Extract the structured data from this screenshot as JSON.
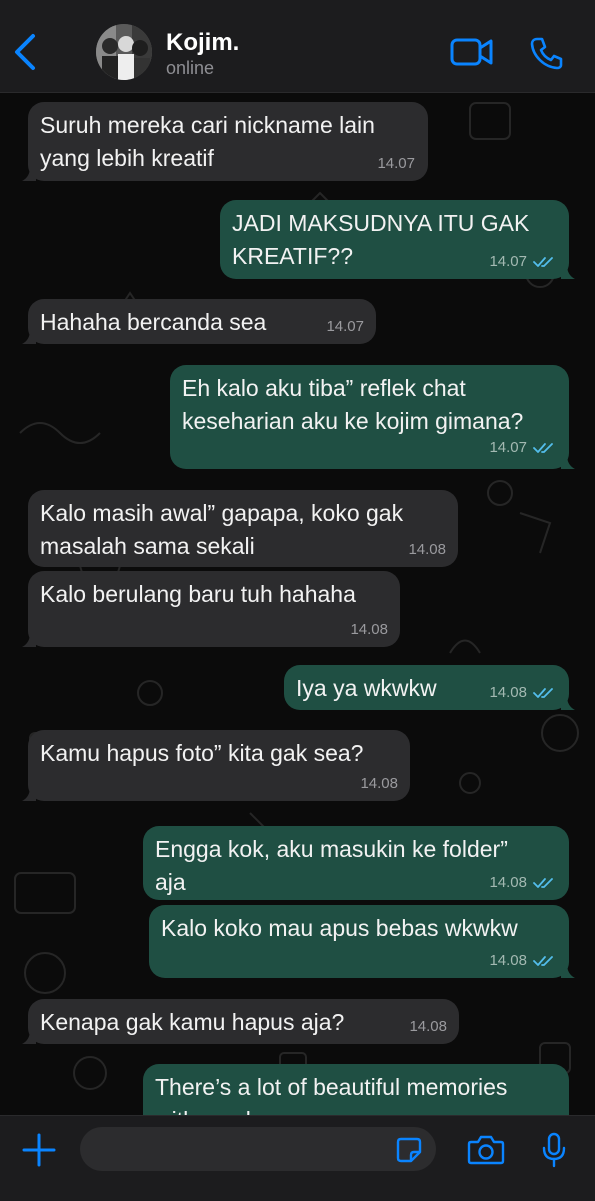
{
  "header": {
    "back_icon": "chevron-left-icon",
    "contact_name": "Kojim.",
    "status": "online",
    "video_icon": "video-camera-icon",
    "call_icon": "phone-icon"
  },
  "colors": {
    "accent": "#0a84ff",
    "incoming_bubble": "#2c2c2e",
    "outgoing_bubble": "#1f4f43",
    "read_ticks": "#53bdeb"
  },
  "messages": [
    {
      "direction": "incoming",
      "lines": [
        "Suruh mereka cari nickname lain",
        "yang lebih kreatif"
      ],
      "time": "14.07"
    },
    {
      "direction": "outgoing",
      "lines": [
        "JADI MAKSUDNYA ITU GAK",
        "KREATIF??"
      ],
      "time": "14.07",
      "status": "read"
    },
    {
      "direction": "incoming",
      "lines": [
        "Hahaha bercanda sea"
      ],
      "time": "14.07"
    },
    {
      "direction": "outgoing",
      "lines": [
        "Eh kalo aku tiba” reflek chat",
        "keseharian aku ke kojim gimana?"
      ],
      "time": "14.07",
      "status": "read"
    },
    {
      "direction": "incoming",
      "lines": [
        "Kalo masih awal” gapapa, koko gak",
        "masalah sama sekali"
      ],
      "time": "14.08"
    },
    {
      "direction": "incoming",
      "lines": [
        "Kalo berulang baru tuh hahaha"
      ],
      "time": "14.08"
    },
    {
      "direction": "outgoing",
      "lines": [
        "Iya ya wkwkw"
      ],
      "time": "14.08",
      "status": "read"
    },
    {
      "direction": "incoming",
      "lines": [
        "Kamu hapus foto” kita gak sea?"
      ],
      "time": "14.08"
    },
    {
      "direction": "outgoing",
      "lines": [
        "Engga kok, aku masukin ke folder”",
        "aja"
      ],
      "time": "14.08",
      "status": "read"
    },
    {
      "direction": "outgoing",
      "lines": [
        "Kalo koko mau apus bebas wkwkw"
      ],
      "time": "14.08",
      "status": "read"
    },
    {
      "direction": "incoming",
      "lines": [
        "Kenapa gak kamu hapus aja?"
      ],
      "time": "14.08"
    },
    {
      "direction": "outgoing",
      "lines": [
        "There’s a lot of beautiful memories",
        "with you ko"
      ],
      "time": "",
      "status": "partial"
    }
  ],
  "composer": {
    "add_icon": "plus-icon",
    "input_value": "",
    "sticker_icon": "sticker-icon",
    "camera_icon": "camera-icon",
    "mic_icon": "microphone-icon"
  }
}
